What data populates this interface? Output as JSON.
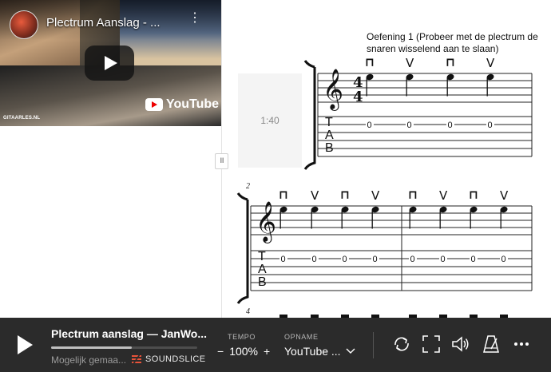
{
  "video": {
    "title": "Plectrum Aanslag - ...",
    "menu_glyph": "⋮",
    "youtube_label": "YouTube",
    "watermark": "GITAARLES.NL"
  },
  "sheet": {
    "exercise_title": "Oefening 1 (Probeer met de plectrum de snaren wisselend aan te slaan)",
    "timestamp": "1:40",
    "measure_numbers": [
      "2",
      "4"
    ],
    "time_signature": {
      "top": "4",
      "bottom": "4"
    },
    "tab_letters": [
      "T",
      "A",
      "B"
    ],
    "downstroke_glyph": "⊓",
    "upstroke_glyph": "V",
    "tab_fret": "0",
    "system1": {
      "strokes": [
        "down",
        "up",
        "down",
        "up"
      ]
    },
    "system2": {
      "measure_a_strokes": [
        "down",
        "up",
        "down",
        "up"
      ],
      "measure_b_strokes": [
        "down",
        "up",
        "down",
        "up"
      ]
    }
  },
  "player": {
    "title": "Plectrum aanslag — JanWo...",
    "subtitle": "Mogelijk gemaa...",
    "brand": "SOUNDSLICE",
    "progress": 0.55,
    "tempo_label": "TEMPO",
    "tempo_minus": "−",
    "tempo_value": "100%",
    "tempo_plus": "+",
    "recording_label": "OPNAME",
    "recording_value": "YouTube ...",
    "icons": [
      "loop-icon",
      "fullscreen-icon",
      "volume-icon",
      "metronome-icon",
      "more-icon"
    ]
  },
  "divider_handle": "III"
}
